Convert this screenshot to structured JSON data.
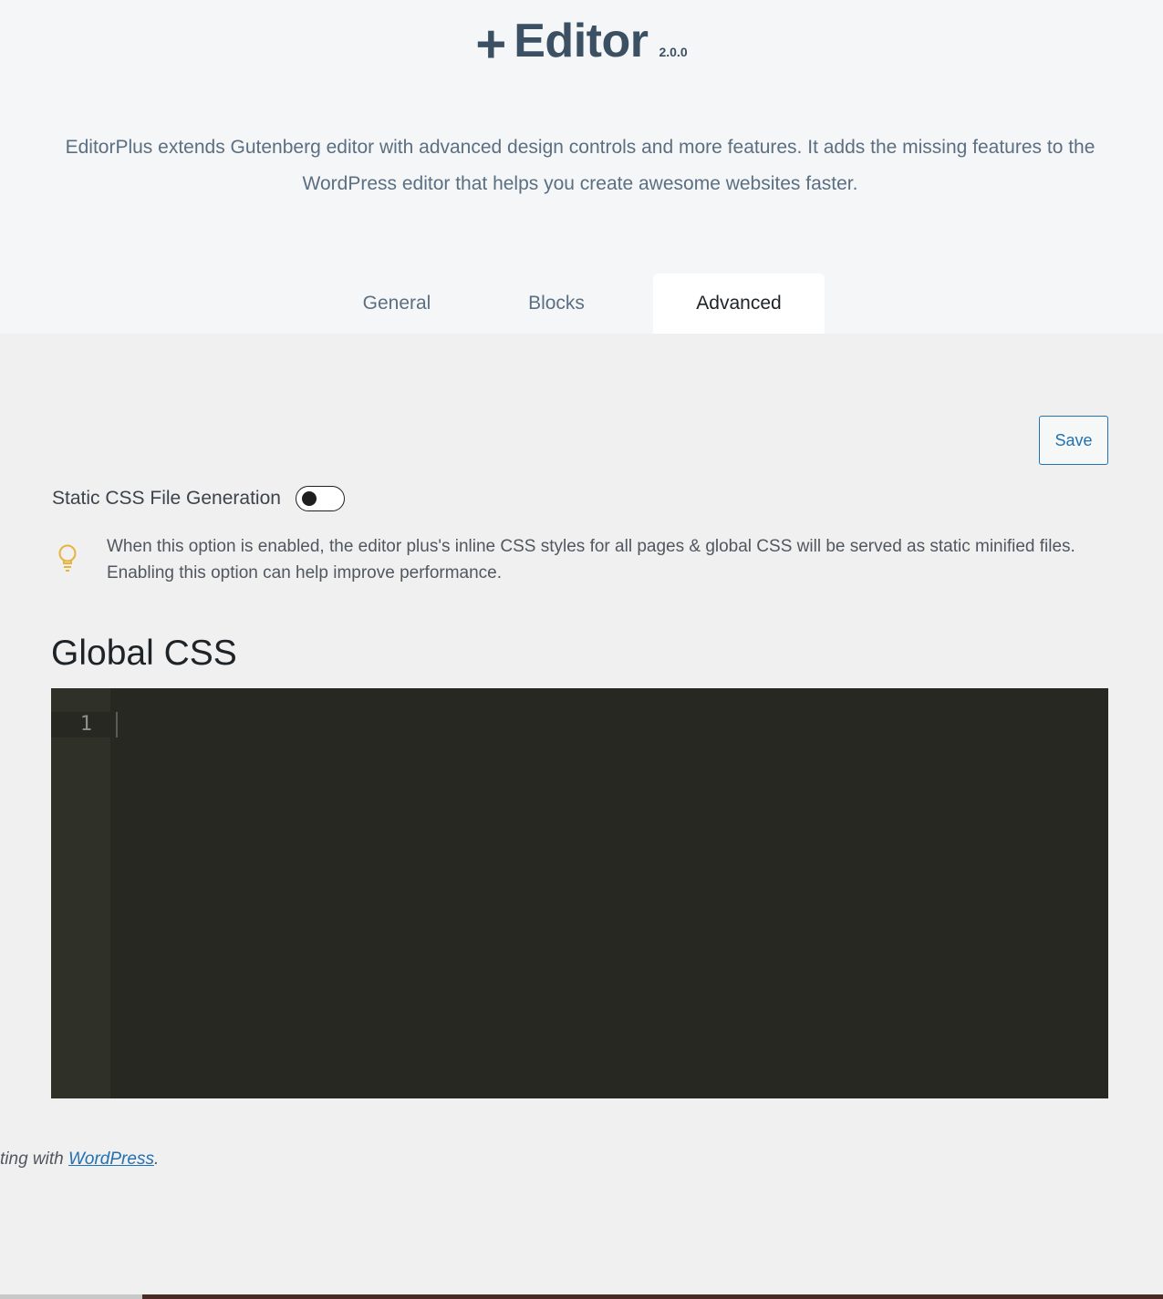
{
  "header": {
    "plus_glyph": "+",
    "brand_name": "Editor",
    "version": "2.0.0",
    "description": "EditorPlus extends Gutenberg editor with advanced design controls and more features. It adds the missing features to the WordPress editor that helps you create awesome websites faster."
  },
  "tabs": [
    {
      "label": "General",
      "active": false
    },
    {
      "label": "Blocks",
      "active": false
    },
    {
      "label": "Advanced",
      "active": true
    }
  ],
  "settings": {
    "save_label": "Save",
    "static_css": {
      "label": "Static CSS File Generation",
      "enabled": false,
      "tip_icon": "lightbulb-icon",
      "tip_text": "When this option is enabled, the editor plus's inline CSS styles for all pages & global CSS will be served as static minified files. Enabling this option can help improve performance."
    }
  },
  "global_css": {
    "heading": "Global CSS",
    "line_numbers": [
      "1"
    ],
    "content": ""
  },
  "footer": {
    "text_prefix": "ting with ",
    "link_text": "WordPress",
    "text_suffix": "."
  },
  "colors": {
    "brand": "#3c5064",
    "accent": "#2271b1",
    "tip_icon": "#e6b43c",
    "editor_bg": "#272822",
    "gutter_bg": "#2f3129"
  }
}
